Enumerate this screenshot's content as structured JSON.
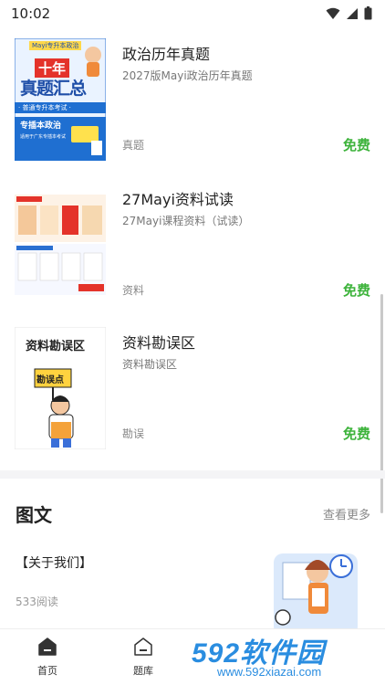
{
  "status_bar": {
    "time": "10:02"
  },
  "resources": [
    {
      "title": "政治历年真题",
      "subtitle": "2027版Mayi政治历年真题",
      "tag": "真题",
      "price": "免费",
      "cover": {
        "header": "Mayi专升本政治",
        "big1": "十年",
        "big2": "真题汇总",
        "band": "· 普通专升本考试 ·",
        "line": "专插本政治",
        "note": "适用于广东专插本考试"
      }
    },
    {
      "title": "27Mayi资料试读",
      "subtitle": "27Mayi课程资料（试读）",
      "tag": "资料",
      "price": "免费"
    },
    {
      "title": "资料勘误区",
      "subtitle": "资料勘误区",
      "tag": "勘误",
      "price": "免费",
      "cover": {
        "heading": "资料勘误区",
        "sign": "勘误点"
      }
    }
  ],
  "articles_section": {
    "title": "图文",
    "more": "查看更多",
    "items": [
      {
        "title": "【关于我们】",
        "reads": "533阅读"
      }
    ]
  },
  "bottom_nav": [
    {
      "label": "首页",
      "icon": "home-icon"
    },
    {
      "label": "题库",
      "icon": "question-bank-icon"
    }
  ],
  "watermark": {
    "brand": "592软件园",
    "url": "www.592xiazai.com"
  },
  "colors": {
    "price": "#3db33b",
    "brand_blue": "#1f6fd1",
    "watermark": "#2a8de0"
  }
}
